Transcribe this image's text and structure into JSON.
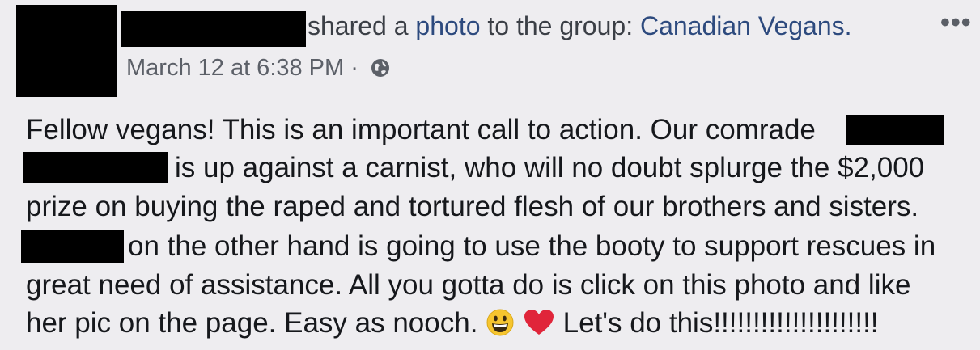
{
  "header": {
    "shared_text": "shared a ",
    "photo_link": "photo",
    "to_group_text": " to the group: ",
    "group_name": "Canadian Vegans.",
    "more_label": "•••"
  },
  "meta": {
    "timestamp": "March 12 at 6:38 PM · "
  },
  "post": {
    "line1": "Fellow vegans! This is an important call to action. Our comrade",
    "line2": "is up against a carnist, who will no doubt splurge the $2,000",
    "line3": "prize on buying the raped and tortured flesh of our brothers and sisters.",
    "line4": "on the other hand is going to use the booty to support rescues in",
    "line5": "great need of assistance. All you gotta do is click on this photo and like",
    "line6a": "her pic on the page. Easy as nooch.",
    "line6b": "Let's do this!!!!!!!!!!!!!!!!!!!!!"
  },
  "icons": {
    "globe": "globe-icon",
    "smile": "grinning-face-icon",
    "heart": "red-heart-icon"
  },
  "colors": {
    "link": "#2d4a7e",
    "heart": "#e0253a",
    "smile": "#f6c52f"
  }
}
